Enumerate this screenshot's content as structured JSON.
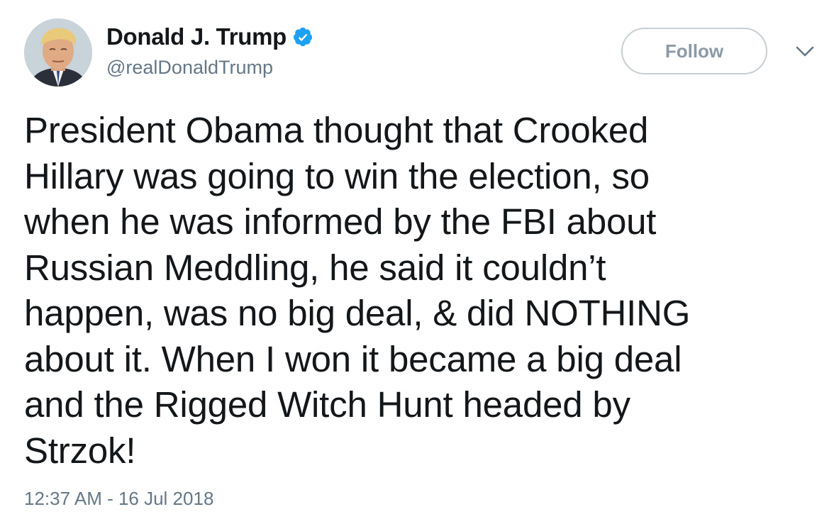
{
  "author": {
    "display_name": "Donald J. Trump",
    "handle": "@realDonaldTrump",
    "verified": true
  },
  "actions": {
    "follow_label": "Follow"
  },
  "tweet": {
    "text": "President Obama thought that Crooked\nHillary was going to win the election, so\nwhen he was informed by the FBI about\nRussian Meddling, he said it couldn’t\nhappen, was no big deal, & did NOTHING\nabout it. When I won it became a big deal\nand the Rigged Witch Hunt headed by\nStrzok!",
    "timestamp": "12:37 AM - 16 Jul 2018"
  },
  "icons": {
    "verified": "verified-badge-icon",
    "more": "chevron-down-icon"
  },
  "colors": {
    "verified_blue": "#1da1f2",
    "secondary_text": "#657786",
    "follow_border": "#c7ced4"
  }
}
